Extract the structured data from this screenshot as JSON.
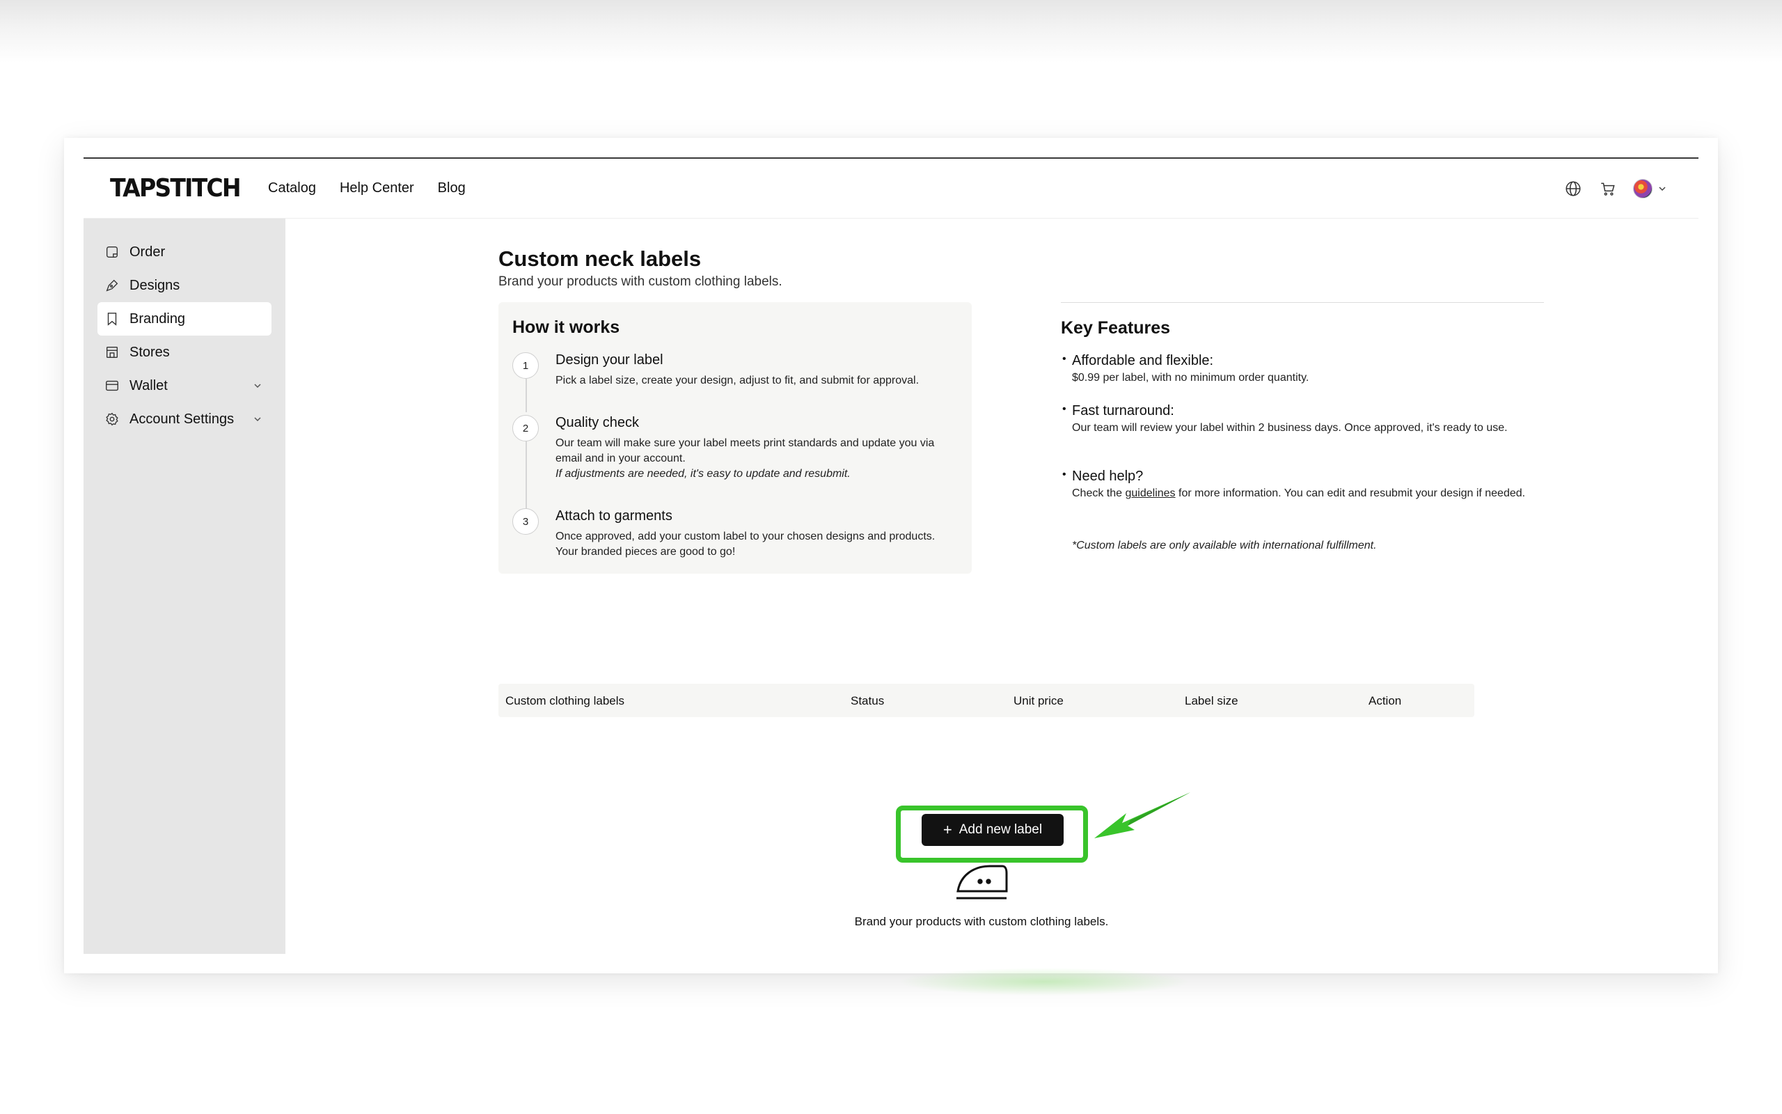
{
  "nav": {
    "logo": "TAPSTITCH",
    "links": [
      "Catalog",
      "Help Center",
      "Blog"
    ],
    "icons": [
      "globe-icon",
      "cart-icon",
      "avatar",
      "chevron-down-icon"
    ]
  },
  "sidebar": {
    "items": [
      {
        "label": "Order",
        "icon": "order-icon"
      },
      {
        "label": "Designs",
        "icon": "pen-icon"
      },
      {
        "label": "Branding",
        "icon": "bookmark-icon",
        "active": true
      },
      {
        "label": "Stores",
        "icon": "store-icon"
      },
      {
        "label": "Wallet",
        "icon": "wallet-icon",
        "expandable": true
      },
      {
        "label": "Account Settings",
        "icon": "gear-icon",
        "expandable": true
      }
    ]
  },
  "page": {
    "title": "Custom neck labels",
    "subtitle": "Brand your products with custom clothing labels."
  },
  "how_it_works": {
    "title": "How it works",
    "steps": [
      {
        "num": "1",
        "title": "Design your label",
        "desc": "Pick a label size, create your design, adjust to fit, and submit for approval.",
        "note": ""
      },
      {
        "num": "2",
        "title": "Quality check",
        "desc": "Our team will make sure your label meets print standards and update you via email and in your account.",
        "note": "If adjustments are needed, it's easy to update and resubmit."
      },
      {
        "num": "3",
        "title": "Attach to garments",
        "desc": "Once approved, add your custom label to your chosen designs and products. Your branded pieces are good to go!",
        "note": ""
      }
    ]
  },
  "key_features": {
    "title": "Key Features",
    "items": [
      {
        "title": "Affordable and flexible:",
        "desc": "$0.99 per label, with no minimum order quantity."
      },
      {
        "title": "Fast turnaround:",
        "desc": "Our team will review your label within 2 business days. Once approved, it's ready to use."
      },
      {
        "title": "Need help?",
        "desc_before": "Check the",
        "link": "guidelines",
        "desc_after": "for more information. You can edit and resubmit your design if needed."
      }
    ],
    "note": "*Custom labels are only available with international fulfillment."
  },
  "table": {
    "columns": [
      "Custom clothing labels",
      "Status",
      "Unit price",
      "Label size",
      "Action"
    ]
  },
  "empty_state": {
    "icon": "iron-icon",
    "text": "Brand your products with custom clothing labels.",
    "button_label": "Add new label",
    "button_icon": "plus-icon"
  },
  "colors": {
    "highlight": "#39c42b",
    "button_bg": "#121212",
    "sidebar_bg": "#e6e6e6",
    "card_bg": "#f6f6f4"
  }
}
